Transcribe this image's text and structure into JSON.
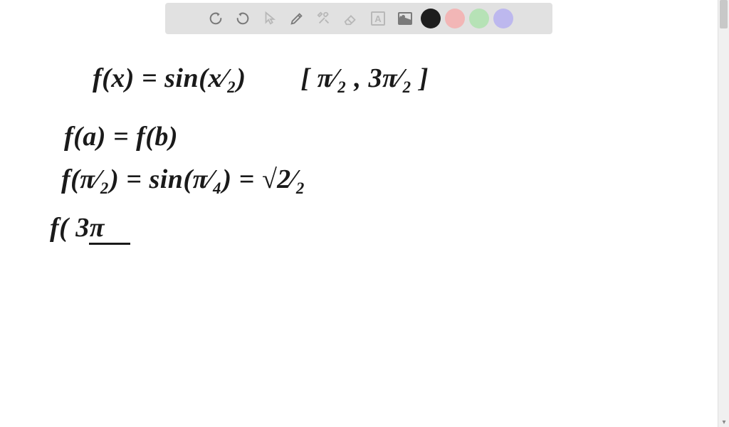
{
  "toolbar": {
    "undo": "undo",
    "redo": "redo",
    "pointer": "pointer",
    "pen": "pen",
    "tools": "tools",
    "eraser": "eraser",
    "textbox_label": "A",
    "image": "image",
    "colors": {
      "black": "#1e1e1e",
      "pink": "#f2b6b6",
      "green": "#b6e2b6",
      "purple": "#bdb8ee"
    }
  },
  "math": {
    "line1": "f(x) = sin(x⁄₂)  [ π⁄₂ , 3π⁄₂ ]",
    "line2": "f(a) = f(b)",
    "line3": "f(π⁄₂) = sin(π⁄₄) = √2⁄₂",
    "line4": "f( 3π"
  }
}
